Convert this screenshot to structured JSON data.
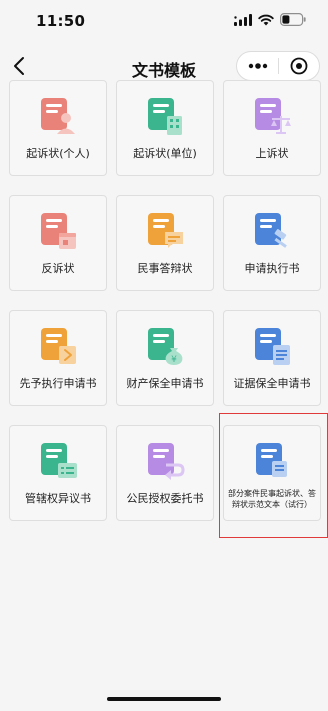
{
  "status_bar": {
    "time": "11:50"
  },
  "nav": {
    "title": "文书模板"
  },
  "cards": [
    {
      "label": "起诉状(个人)",
      "color": "#e9837a",
      "icon": "person-document-icon"
    },
    {
      "label": "起诉状(单位)",
      "color": "#3bb58e",
      "icon": "building-document-icon"
    },
    {
      "label": "上诉状",
      "color": "#b68be3",
      "icon": "scales-document-icon"
    },
    {
      "label": "反诉状",
      "color": "#e9837a",
      "icon": "calendar-document-icon"
    },
    {
      "label": "民事答辩状",
      "color": "#f0a23a",
      "icon": "chat-document-icon"
    },
    {
      "label": "申请执行书",
      "color": "#4b84d9",
      "icon": "gavel-document-icon"
    },
    {
      "label": "先予执行申请书",
      "color": "#f0a23a",
      "icon": "forward-document-icon"
    },
    {
      "label": "财产保全申请书",
      "color": "#3bb58e",
      "icon": "money-bag-document-icon"
    },
    {
      "label": "证据保全申请书",
      "color": "#4b84d9",
      "icon": "file-stack-document-icon"
    },
    {
      "label": "管辖权异议书",
      "color": "#3bb58e",
      "icon": "list-document-icon"
    },
    {
      "label": "公民授权委托书",
      "color": "#b68be3",
      "icon": "return-document-icon"
    },
    {
      "label": "部分案件民事起诉状、答辩状示范文本（试行）",
      "color": "#4b84d9",
      "icon": "sample-document-icon"
    }
  ],
  "highlight_color": "#e03a3a"
}
